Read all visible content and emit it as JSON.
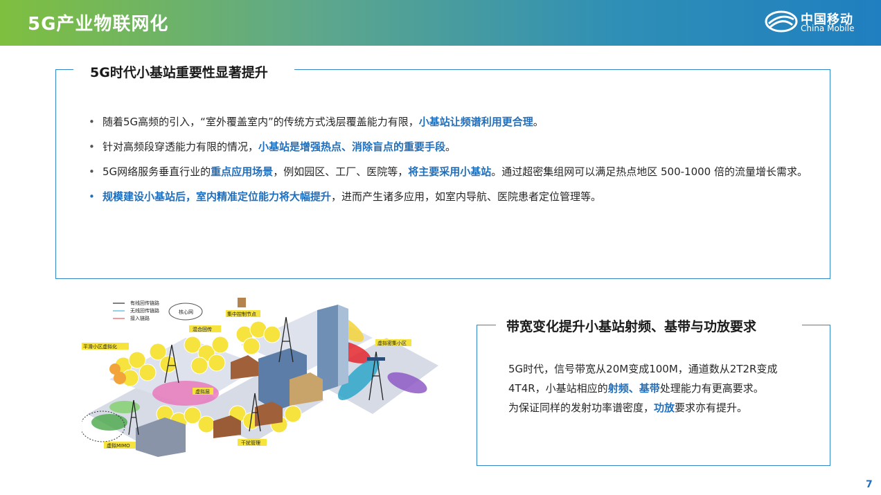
{
  "header": {
    "title": "5G产业物联网化",
    "logo_cn": "中国移动",
    "logo_en": "China Mobile"
  },
  "section1": {
    "title": "5G时代小基站重要性显著提升",
    "bullets": [
      {
        "parts": [
          {
            "text": "随着5G高频的引入，“室外覆盖室内”的传统方式浅层覆盖能力有限，",
            "hl": false
          },
          {
            "text": "小基站让频谱利用更合理",
            "hl": true
          },
          {
            "text": "。",
            "hl": false
          }
        ]
      },
      {
        "parts": [
          {
            "text": "针对高频段穿透能力有限的情况，",
            "hl": false
          },
          {
            "text": "小基站是增强热点、消除盲点的重要手段",
            "hl": true
          },
          {
            "text": "。",
            "hl": false
          }
        ]
      },
      {
        "parts": [
          {
            "text": "5G网络服务垂直行业的",
            "hl": false
          },
          {
            "text": "重点应用场景",
            "hl": true
          },
          {
            "text": "，例如园区、工厂、医院等，",
            "hl": false
          },
          {
            "text": "将主要采用小基站",
            "hl": true
          },
          {
            "text": "。通过超密集组网可以满足热点地区 500-1000 倍的流量增长需求。",
            "hl": false
          }
        ]
      },
      {
        "parts": [
          {
            "text": "规模建设小基站后，室内精准定位能力将大幅提升",
            "hl": true
          },
          {
            "text": "，进而产生诸多应用，如室内导航、医院患者定位管理等。",
            "hl": false
          }
        ]
      }
    ]
  },
  "section2": {
    "title": "带宽变化提升小基站射频、基带与功放要求",
    "line1": "5G时代，信号带宽从20M变成100M，通道数从2T2R变成4T4R，小基站相应的",
    "line1_hl": "射频、基带",
    "line1_end": "处理能力有更高要求。",
    "line2": "为保证同样的发射功率谱密度，",
    "line2_hl": "功放",
    "line2_end": "要求亦有提升。"
  },
  "diagram": {
    "legend": [
      "有线回传链路",
      "无线回传链路",
      "接入链路"
    ],
    "labels": {
      "core": "核心网",
      "central": "集中控制节点",
      "mixed": "混合回传",
      "smooth": "平滑小区虚拟化",
      "dense": "虚拟密集小区",
      "virtual": "虚拟层",
      "mimo": "虚拟MIMO",
      "interference": "干扰管理"
    },
    "colors": {
      "cell": "#f7e33d",
      "accent": "#1f6fbf"
    }
  },
  "page_number": "7"
}
